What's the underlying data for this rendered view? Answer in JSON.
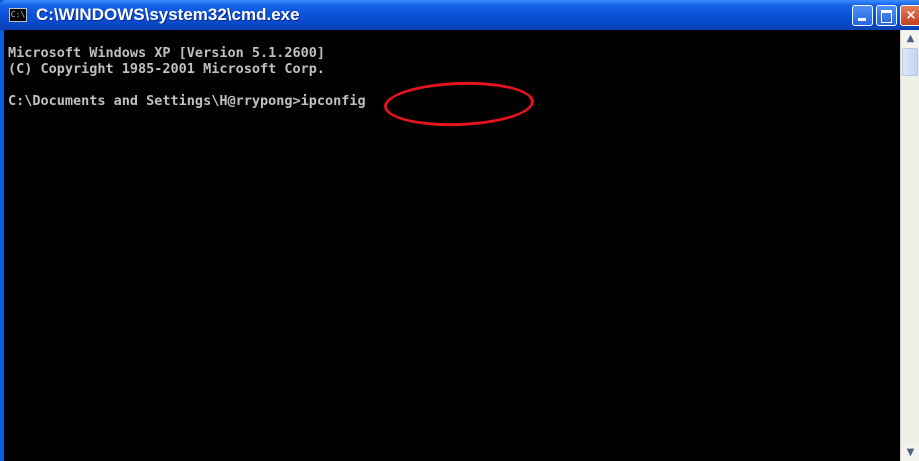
{
  "window": {
    "title": "C:\\WINDOWS\\system32\\cmd.exe",
    "app_icon_text": "C:\\",
    "controls": {
      "minimize": "minimize",
      "maximize": "maximize",
      "close": "×"
    }
  },
  "console": {
    "lines": [
      "Microsoft Windows XP [Version 5.1.2600]",
      "(C) Copyright 1985-2001 Microsoft Corp.",
      "C:\\Documents and Settings\\H@rrypong>ipconfig"
    ],
    "colors": {
      "background": "#000000",
      "text": "#c0c0c0",
      "annotation": "#e4141b"
    }
  },
  "scrollbar": {
    "up_arrow": "▲",
    "down_arrow": "▼"
  }
}
